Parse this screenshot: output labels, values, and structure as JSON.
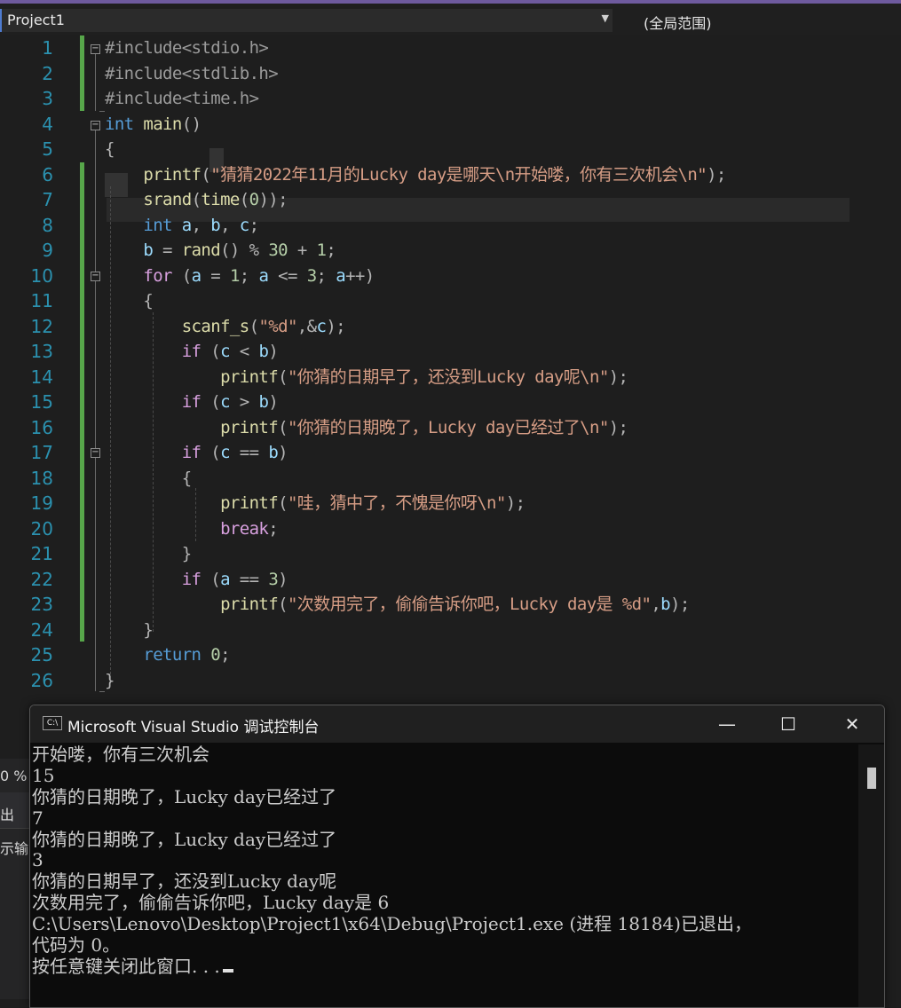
{
  "nav": {
    "project": "Project1",
    "scope": "(全局范围)"
  },
  "editor": {
    "line_numbers": [
      "1",
      "2",
      "3",
      "4",
      "5",
      "6",
      "7",
      "8",
      "9",
      "10",
      "11",
      "12",
      "13",
      "14",
      "15",
      "16",
      "17",
      "18",
      "19",
      "20",
      "21",
      "22",
      "23",
      "24",
      "25",
      "26"
    ],
    "lines": [
      "#include<stdio.h>",
      "#include<stdlib.h>",
      "#include<time.h>",
      "int main()",
      "{",
      "    printf(\"猜猜2022年11月的Lucky day是哪天\\n开始喽，你有三次机会\\n\");",
      "    srand(time(0));",
      "    int a, b, c;",
      "    b = rand() % 30 + 1;",
      "    for (a = 1; a <= 3; a++)",
      "    {",
      "        scanf_s(\"%d\",&c);",
      "        if (c < b)",
      "            printf(\"你猜的日期早了，还没到Lucky day呢\\n\");",
      "        if (c > b)",
      "            printf(\"你猜的日期晚了，Lucky day已经过了\\n\");",
      "        if (c == b)",
      "        {",
      "            printf(\"哇，猜中了，不愧是你呀\\n\");",
      "            break;",
      "        }",
      "        if (a == 3)",
      "            printf(\"次数用完了，偷偷告诉你吧，Lucky day是 %d\",b);",
      "    }",
      "    return 0;",
      "}"
    ]
  },
  "side_panel": {
    "zoom": "0 %",
    "tab_output": "出",
    "show_output_from": "示输"
  },
  "console": {
    "icon_text": "C:\\",
    "title": "Microsoft Visual Studio 调试控制台",
    "minimize": "—",
    "maximize": "☐",
    "close": "✕",
    "output": [
      "开始喽，你有三次机会",
      "15",
      "你猜的日期晚了，Lucky day已经过了",
      "7",
      "你猜的日期晚了，Lucky day已经过了",
      "3",
      "你猜的日期早了，还没到Lucky day呢",
      "次数用完了，偷偷告诉你吧，Lucky day是 6",
      "C:\\Users\\Lenovo\\Desktop\\Project1\\x64\\Debug\\Project1.exe (进程 18184)已退出，",
      "代码为 0。",
      "按任意键关闭此窗口. . ."
    ]
  },
  "colors": {
    "keyword": "#569cd6",
    "function": "#dcdcaa",
    "string": "#d69d85",
    "line_number": "#2b91af",
    "change_bar": "#57a64a"
  }
}
